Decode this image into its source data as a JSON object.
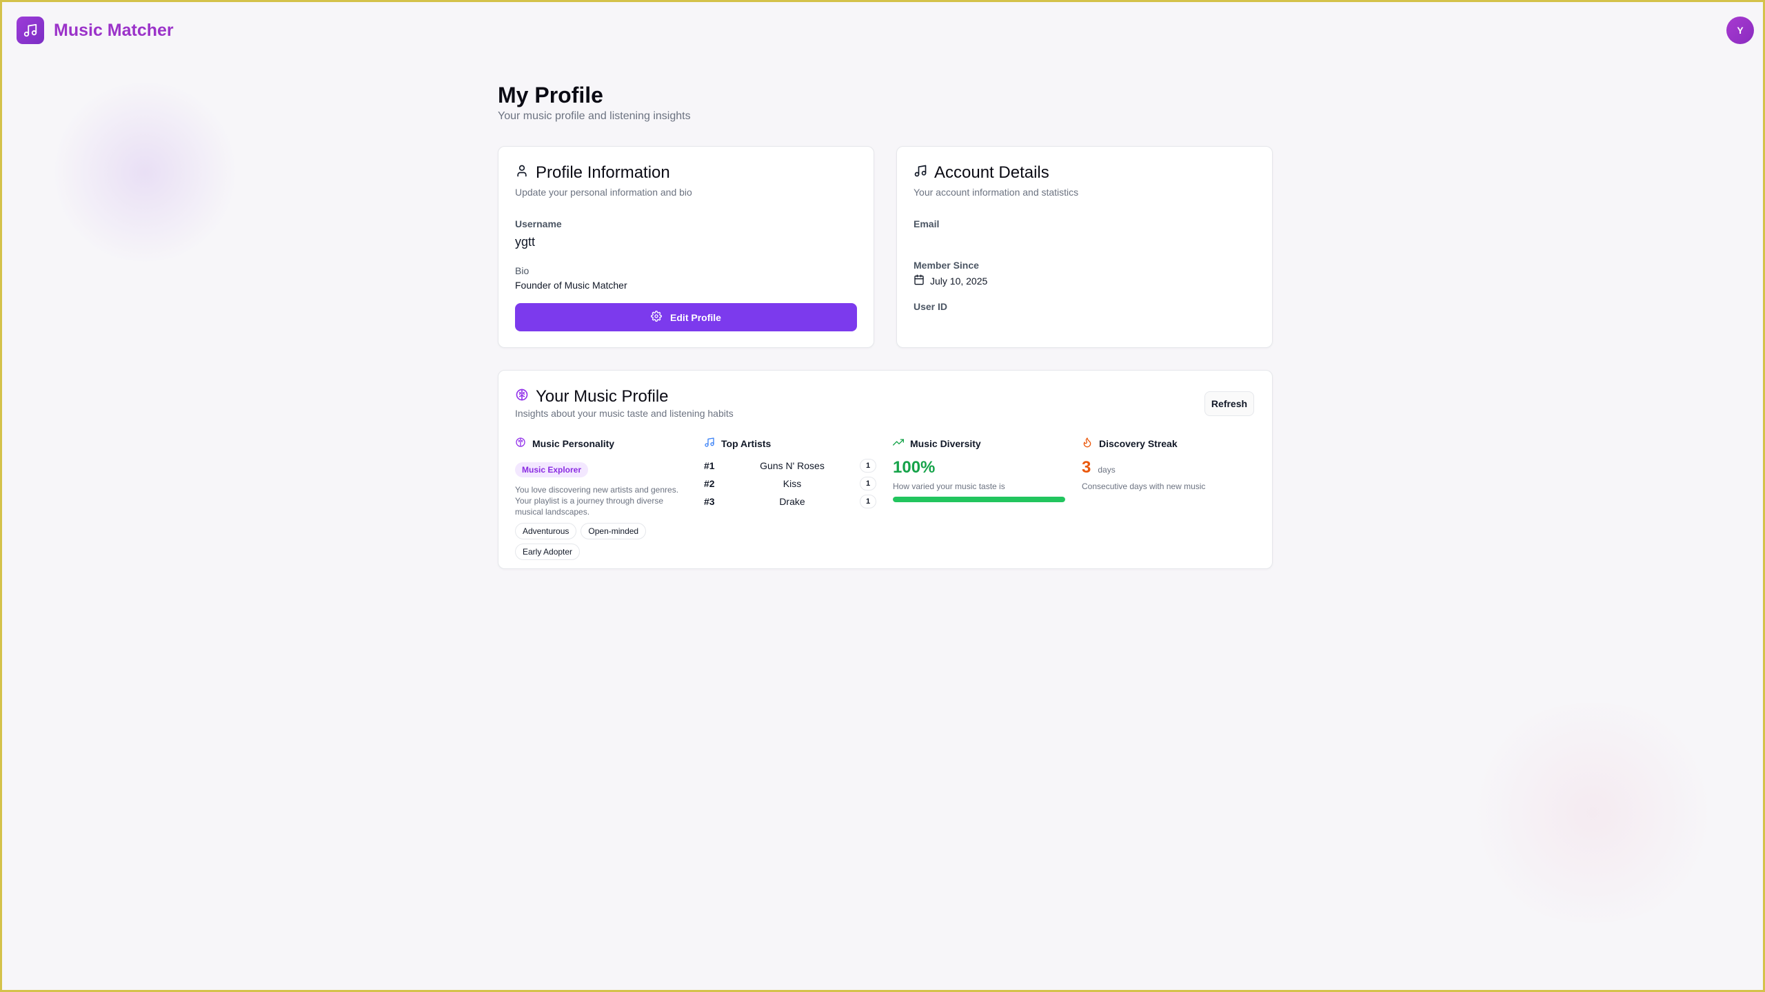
{
  "app": {
    "name": "Music Matcher",
    "avatar_initial": "Y"
  },
  "page": {
    "title": "My Profile",
    "subtitle": "Your music profile and listening insights"
  },
  "profile_card": {
    "title": "Profile Information",
    "subtitle": "Update your personal information and bio",
    "username_label": "Username",
    "username": "ygtt",
    "bio_label": "Bio",
    "bio": "Founder of Music Matcher",
    "edit_button": "Edit Profile"
  },
  "account_card": {
    "title": "Account Details",
    "subtitle": "Your account information and statistics",
    "email_label": "Email",
    "member_since_label": "Member Since",
    "member_since": "July 10, 2025",
    "user_id_label": "User ID"
  },
  "music_profile": {
    "title": "Your Music Profile",
    "subtitle": "Insights about your music taste and listening habits",
    "refresh_button": "Refresh",
    "personality": {
      "heading": "Music Personality",
      "type": "Music Explorer",
      "description": "You love discovering new artists and genres. Your playlist is a journey through diverse musical landscapes.",
      "tags": [
        "Adventurous",
        "Open-minded",
        "Early Adopter"
      ]
    },
    "top_artists": {
      "heading": "Top Artists",
      "items": [
        {
          "rank": "#1",
          "name": "Guns N' Roses",
          "count": "1"
        },
        {
          "rank": "#2",
          "name": "Kiss",
          "count": "1"
        },
        {
          "rank": "#3",
          "name": "Drake",
          "count": "1"
        }
      ]
    },
    "diversity": {
      "heading": "Music Diversity",
      "value": "100%",
      "fraction": 1.0,
      "caption": "How varied your music taste is"
    },
    "streak": {
      "heading": "Discovery Streak",
      "value": "3",
      "unit": "days",
      "caption": "Consecutive days with new music"
    }
  },
  "colors": {
    "brand": "#9b33c9",
    "primary_button": "#7c3aed",
    "diversity_green": "#16a34a",
    "streak_orange": "#ea580c"
  },
  "icons": {
    "brand": "music-note-icon",
    "profile": "user-icon",
    "account": "music-note-icon",
    "music_profile": "brain-icon",
    "personality": "brain-icon",
    "top_artists": "music-note-icon",
    "diversity": "trending-up-icon",
    "streak": "flame-icon",
    "calendar": "calendar-icon",
    "settings": "gear-icon"
  }
}
